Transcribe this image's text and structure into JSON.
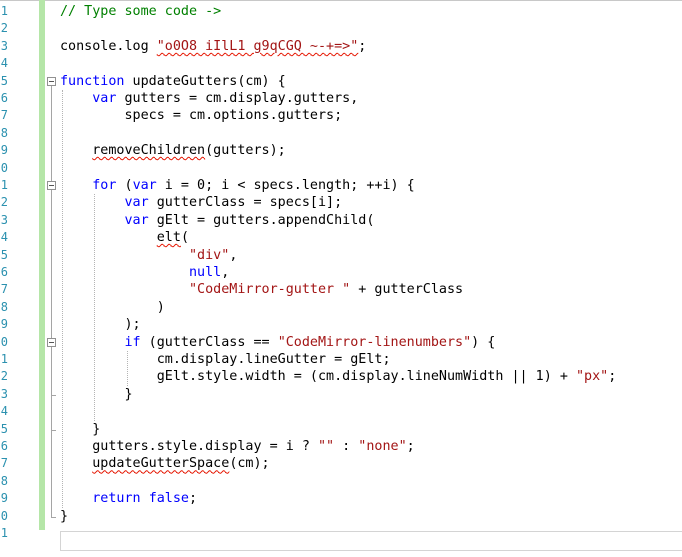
{
  "editor": {
    "line_numbers": [
      "1",
      "2",
      "3",
      "4",
      "5",
      "6",
      "7",
      "8",
      "9",
      "0",
      "1",
      "2",
      "3",
      "4",
      "5",
      "6",
      "7",
      "8",
      "9",
      "0",
      "1",
      "2",
      "3",
      "4",
      "5",
      "6",
      "7",
      "8",
      "9",
      "0",
      "1"
    ],
    "lines": [
      [
        {
          "t": "// Type some code ->",
          "c": "c"
        }
      ],
      [],
      [
        {
          "t": "console.log "
        },
        {
          "t": "\"o0O8 iIlL1 g9qCGQ ~-+=>\"",
          "c": "s sq"
        },
        {
          "t": ";"
        }
      ],
      [],
      [
        {
          "t": "function",
          "c": "k"
        },
        {
          "t": " updateGutters(cm) {"
        }
      ],
      [
        {
          "t": "    "
        },
        {
          "t": "var",
          "c": "k"
        },
        {
          "t": " gutters = cm.display.gutters,"
        }
      ],
      [
        {
          "t": "        specs = cm.options.gutters;"
        }
      ],
      [],
      [
        {
          "t": "    "
        },
        {
          "t": "removeChildren",
          "c": "sq"
        },
        {
          "t": "(gutters);"
        }
      ],
      [],
      [
        {
          "t": "    "
        },
        {
          "t": "for",
          "c": "k"
        },
        {
          "t": " ("
        },
        {
          "t": "var",
          "c": "k"
        },
        {
          "t": " i = 0; i < specs.length; ++i) {"
        }
      ],
      [
        {
          "t": "        "
        },
        {
          "t": "var",
          "c": "k"
        },
        {
          "t": " gutterClass = specs[i];"
        }
      ],
      [
        {
          "t": "        "
        },
        {
          "t": "var",
          "c": "k"
        },
        {
          "t": " gElt = gutters.appendChild("
        }
      ],
      [
        {
          "t": "            "
        },
        {
          "t": "elt",
          "c": "sq"
        },
        {
          "t": "("
        }
      ],
      [
        {
          "t": "                "
        },
        {
          "t": "\"div\"",
          "c": "s"
        },
        {
          "t": ","
        }
      ],
      [
        {
          "t": "                "
        },
        {
          "t": "null",
          "c": "k"
        },
        {
          "t": ","
        }
      ],
      [
        {
          "t": "                "
        },
        {
          "t": "\"CodeMirror-gutter \"",
          "c": "s"
        },
        {
          "t": " + gutterClass"
        }
      ],
      [
        {
          "t": "            )"
        }
      ],
      [
        {
          "t": "        );"
        }
      ],
      [
        {
          "t": "        "
        },
        {
          "t": "if",
          "c": "k"
        },
        {
          "t": " (gutterClass == "
        },
        {
          "t": "\"CodeMirror-linenumbers\"",
          "c": "s"
        },
        {
          "t": ") {"
        }
      ],
      [
        {
          "t": "            cm.display.lineGutter = gElt;"
        }
      ],
      [
        {
          "t": "            gElt.style.width = (cm.display.lineNumWidth || 1) + "
        },
        {
          "t": "\"px\"",
          "c": "s"
        },
        {
          "t": ";"
        }
      ],
      [
        {
          "t": "        }"
        }
      ],
      [],
      [
        {
          "t": "    }"
        }
      ],
      [
        {
          "t": "    gutters.style.display = i ? "
        },
        {
          "t": "\"\"",
          "c": "s"
        },
        {
          "t": " : "
        },
        {
          "t": "\"none\"",
          "c": "s"
        },
        {
          "t": ";"
        }
      ],
      [
        {
          "t": "    "
        },
        {
          "t": "updateGutterSpace",
          "c": "sq"
        },
        {
          "t": "(cm);"
        }
      ],
      [],
      [
        {
          "t": "    "
        },
        {
          "t": "return",
          "c": "k"
        },
        {
          "t": " "
        },
        {
          "t": "false",
          "c": "k"
        },
        {
          "t": ";"
        }
      ],
      [
        {
          "t": "}"
        }
      ],
      []
    ],
    "colors": {
      "line_number": "#2b91af",
      "comment": "#008000",
      "keyword": "#0000ff",
      "string": "#a31515",
      "squiggle": "#e51400",
      "change_bar": "#b5e6a8"
    },
    "input_value": ""
  }
}
